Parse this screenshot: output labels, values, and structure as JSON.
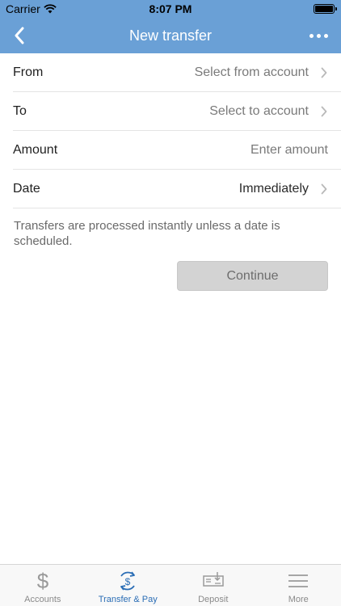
{
  "status_bar": {
    "carrier": "Carrier",
    "time": "8:07 PM"
  },
  "nav": {
    "title": "New transfer",
    "back_icon": "chevron-left-icon",
    "more_icon": "ellipsis-icon"
  },
  "form": {
    "from": {
      "label": "From",
      "value": "Select from account"
    },
    "to": {
      "label": "To",
      "value": "Select to account"
    },
    "amount": {
      "label": "Amount",
      "placeholder": "Enter amount"
    },
    "date": {
      "label": "Date",
      "value": "Immediately"
    }
  },
  "note": "Transfers are processed instantly unless a date is scheduled.",
  "continue_label": "Continue",
  "tabs": [
    {
      "label": "Accounts",
      "icon": "dollar-icon"
    },
    {
      "label": "Transfer & Pay",
      "icon": "transfer-dollar-icon",
      "active": true
    },
    {
      "label": "Deposit",
      "icon": "check-deposit-icon"
    },
    {
      "label": "More",
      "icon": "menu-icon"
    }
  ],
  "colors": {
    "header": "#6aa0d6",
    "active_tab": "#2a6db5",
    "button": "#d3d3d3"
  }
}
